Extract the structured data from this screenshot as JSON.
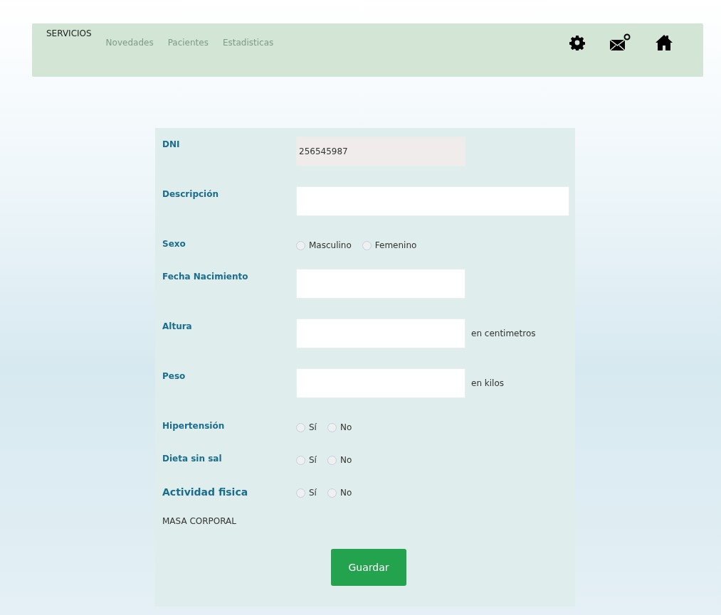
{
  "nav": {
    "brand": "SERVICIOS",
    "links": [
      {
        "label": "Novedades"
      },
      {
        "label": "Pacientes"
      },
      {
        "label": "Estadisticas"
      }
    ],
    "icons": [
      {
        "kind": "gear"
      },
      {
        "kind": "mail"
      },
      {
        "kind": "home"
      }
    ]
  },
  "form": {
    "rows": [
      {
        "kind": "text",
        "label": "DNI",
        "value": "256545987",
        "disabled": true
      },
      {
        "kind": "text",
        "label": "Descripción",
        "wide": true
      },
      {
        "kind": "radio",
        "label": "Sexo",
        "options": [
          {
            "label": "Masculino",
            "selected": false
          },
          {
            "label": "Femenino",
            "selected": false
          }
        ]
      },
      {
        "kind": "text",
        "label": "Fecha Nacimiento"
      },
      {
        "kind": "text",
        "label": "Altura",
        "unit": "en centimetros"
      },
      {
        "kind": "text",
        "label": "Peso",
        "unit": "en kilos"
      },
      {
        "kind": "radio",
        "label": "Hipertensión",
        "options": [
          {
            "label": "Sí",
            "selected": false
          },
          {
            "label": "No",
            "selected": false
          }
        ]
      },
      {
        "kind": "radio",
        "label": "Dieta sin sal",
        "options": [
          {
            "label": "Sí",
            "selected": false
          },
          {
            "label": "No",
            "selected": false
          }
        ]
      },
      {
        "kind": "radio",
        "label": "Actividad fisica",
        "large": true,
        "options": [
          {
            "label": "Sí",
            "selected": false
          },
          {
            "label": "No",
            "selected": false
          }
        ]
      }
    ],
    "note": "MASA CORPORAL",
    "submit": "Guardar"
  }
}
